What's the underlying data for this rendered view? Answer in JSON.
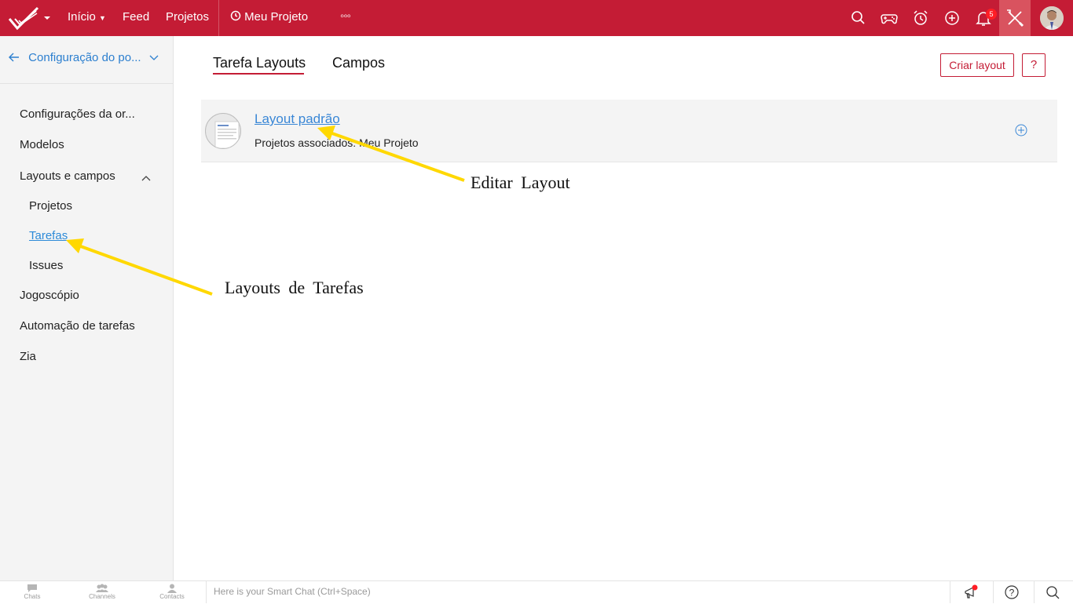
{
  "topbar": {
    "nav": {
      "inicio": "Início",
      "feed": "Feed",
      "projetos": "Projetos",
      "project": "Meu Projeto",
      "more": "◦◦◦"
    },
    "notification_count": "5",
    "brand_color": "#c41c35",
    "icons": [
      "logo-icon",
      "clock-icon",
      "search-icon",
      "gamepad-icon",
      "alarm-icon",
      "add-icon",
      "bell-icon",
      "tools-icon"
    ]
  },
  "sidebar": {
    "back_label": "Configuração do po...",
    "items": [
      {
        "label": "Configurações da or..."
      },
      {
        "label": "Modelos"
      },
      {
        "label": "Layouts e campos"
      },
      {
        "label": "Projetos"
      },
      {
        "label": "Tarefas"
      },
      {
        "label": "Issues"
      },
      {
        "label": "Jogoscópio"
      },
      {
        "label": "Automação de tarefas"
      },
      {
        "label": "Zia"
      }
    ]
  },
  "main": {
    "tabs": [
      {
        "label": "Tarefa Layouts"
      },
      {
        "label": "Campos"
      }
    ],
    "create_button": "Criar layout",
    "help_button": "?",
    "layout": {
      "title": "Layout padrão",
      "associated": "Projetos associados: Meu Projeto"
    }
  },
  "annotations": {
    "edit_layout": "Editar Layout",
    "task_layouts": "Layouts de Tarefas",
    "arrow_color": "#ffd800"
  },
  "bottombar": {
    "chats": "Chats",
    "channels": "Channels",
    "contacts": "Contacts",
    "smartchat_placeholder": "Here is your Smart Chat (Ctrl+Space)"
  }
}
